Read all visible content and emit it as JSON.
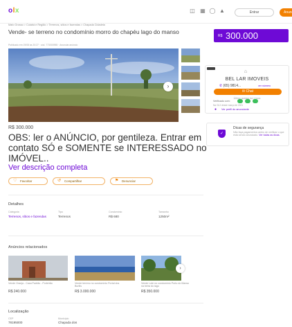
{
  "header": {
    "logo": {
      "o": "o",
      "l": "l",
      "x": "x"
    },
    "entrar_label": "Entrar",
    "anunciar_label": "Anunciar"
  },
  "breadcrumb": "Mato Grosso  >  Cuiabá e Região  >  Terrenos, sítios e fazendas  >  Chapada Cidadela",
  "listing": {
    "title": "Vende- se terreno no condomínio morro do chapéu lago do manso",
    "meta": "Publicado em 19/08 às 20:27  ·  cód. 773000955  ·  Anunciar anúncio",
    "price": "R$ 300.000",
    "price_prefix": "R$",
    "price_value": "300.000",
    "description": "OBS: ler o ANÚNCIO, por gentileza. Entrar em contato SÓ e SOMENTE se INTERESSADO no IMÓVEL..",
    "ver_descricao": "Ver descrição completa",
    "actions": {
      "favoritar": "Favoritar",
      "compartilhar": "Compartilhar",
      "denunciar": "Denunciar"
    }
  },
  "details": {
    "title": "Detalhes",
    "categoria_label": "Categoria",
    "categoria_value": "Terrenos, sítios e fazendas",
    "tipo_label": "Tipo",
    "tipo_value": "Terrenos",
    "condominio_label": "Condomínio",
    "condominio_value": "R$ 680",
    "tamanho_label": "Tamanho",
    "tamanho_value": "1250m²"
  },
  "related": {
    "title": "Anúncios relacionados",
    "items": [
      {
        "name": "Vende Granja - Casa Padrão - Porteirão",
        "price": "R$ 240.000"
      },
      {
        "name": "Vende terreno no condomínio Portal dos Buritis",
        "price": "R$ 3.000.000"
      },
      {
        "name": "Vende Lote no condomínio Porto do Manso na beira do lago",
        "price": "R$ 350.000"
      }
    ]
  },
  "location": {
    "title": "Localização",
    "cep_label": "CEP",
    "cep_value": "78195000",
    "municipio_label": "Município",
    "municipio_value": "Chapada dos"
  },
  "seller": {
    "name": "BEL LAR IMOVEIS",
    "phone": "(65) 9814...",
    "ver_numero": "ver número",
    "chat_label": "Chat",
    "online": "Último acesso há 1 hora",
    "verificados": "Verificado com:",
    "membro": "Na OLX desde março de 2021",
    "ver_perfil": "Ver perfil do anunciante"
  },
  "safety": {
    "title": "Dicas de segurança",
    "text": "Não faça pagamentos antes de verificar o que está sendo anunciado.",
    "link": "Ver todas as dicas."
  },
  "colors": {
    "purple": "#6e0ad6",
    "orange": "#f28000",
    "green": "#3cbf5b"
  },
  "icons": {
    "header": [
      "bag-icon",
      "grid-icon",
      "chat-icon",
      "bell-icon"
    ],
    "chips": [
      "heart-icon",
      "share-icon",
      "flag-icon"
    ],
    "next": "chevron-right-icon"
  }
}
